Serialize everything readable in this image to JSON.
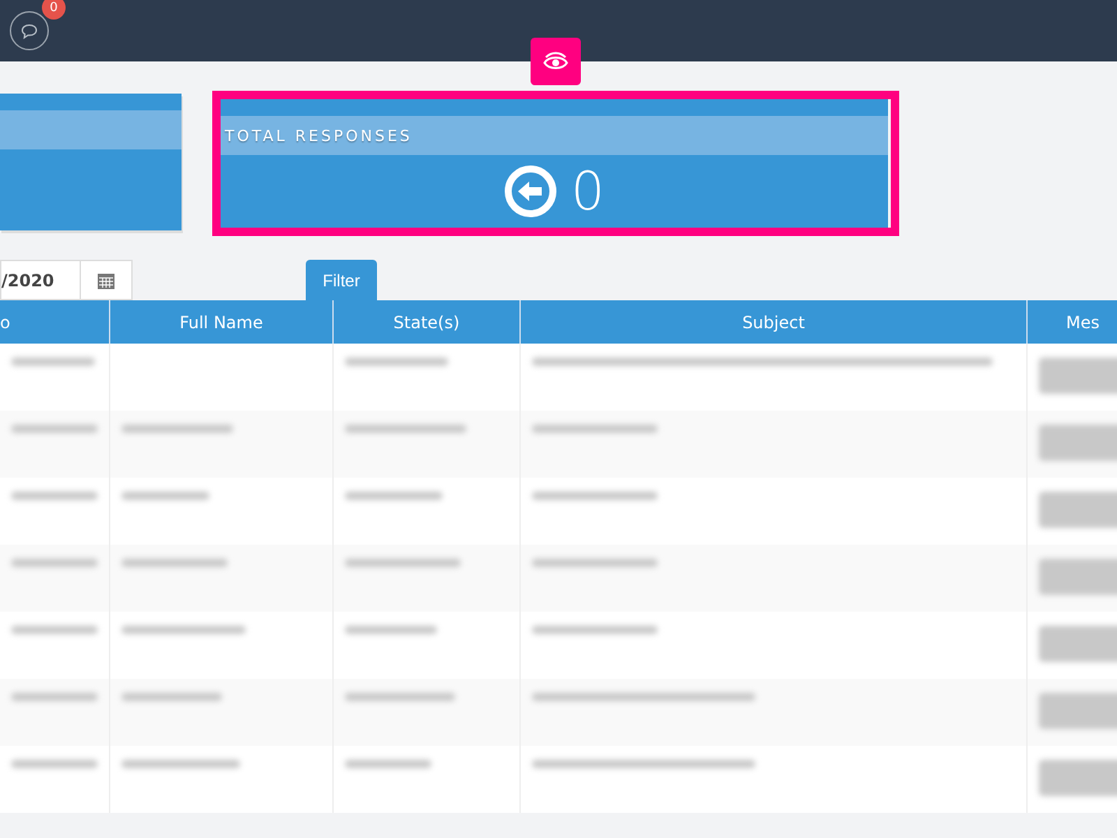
{
  "header": {
    "notifications": {
      "count": "0"
    }
  },
  "stat_card": {
    "title": "TOTAL RESPONSES",
    "value": "0",
    "highlighted": true
  },
  "filters": {
    "date_value": "/2020",
    "filter_tab": "Filter"
  },
  "table": {
    "columns": [
      "o",
      "Full Name",
      "State(s)",
      "Subject",
      "Mes"
    ],
    "rows": [
      {
        "kind": "blurred"
      },
      {
        "kind": "blurred"
      },
      {
        "kind": "blurred"
      },
      {
        "kind": "blurred"
      },
      {
        "kind": "blurred"
      },
      {
        "kind": "blurred"
      },
      {
        "kind": "blurred"
      }
    ]
  }
}
